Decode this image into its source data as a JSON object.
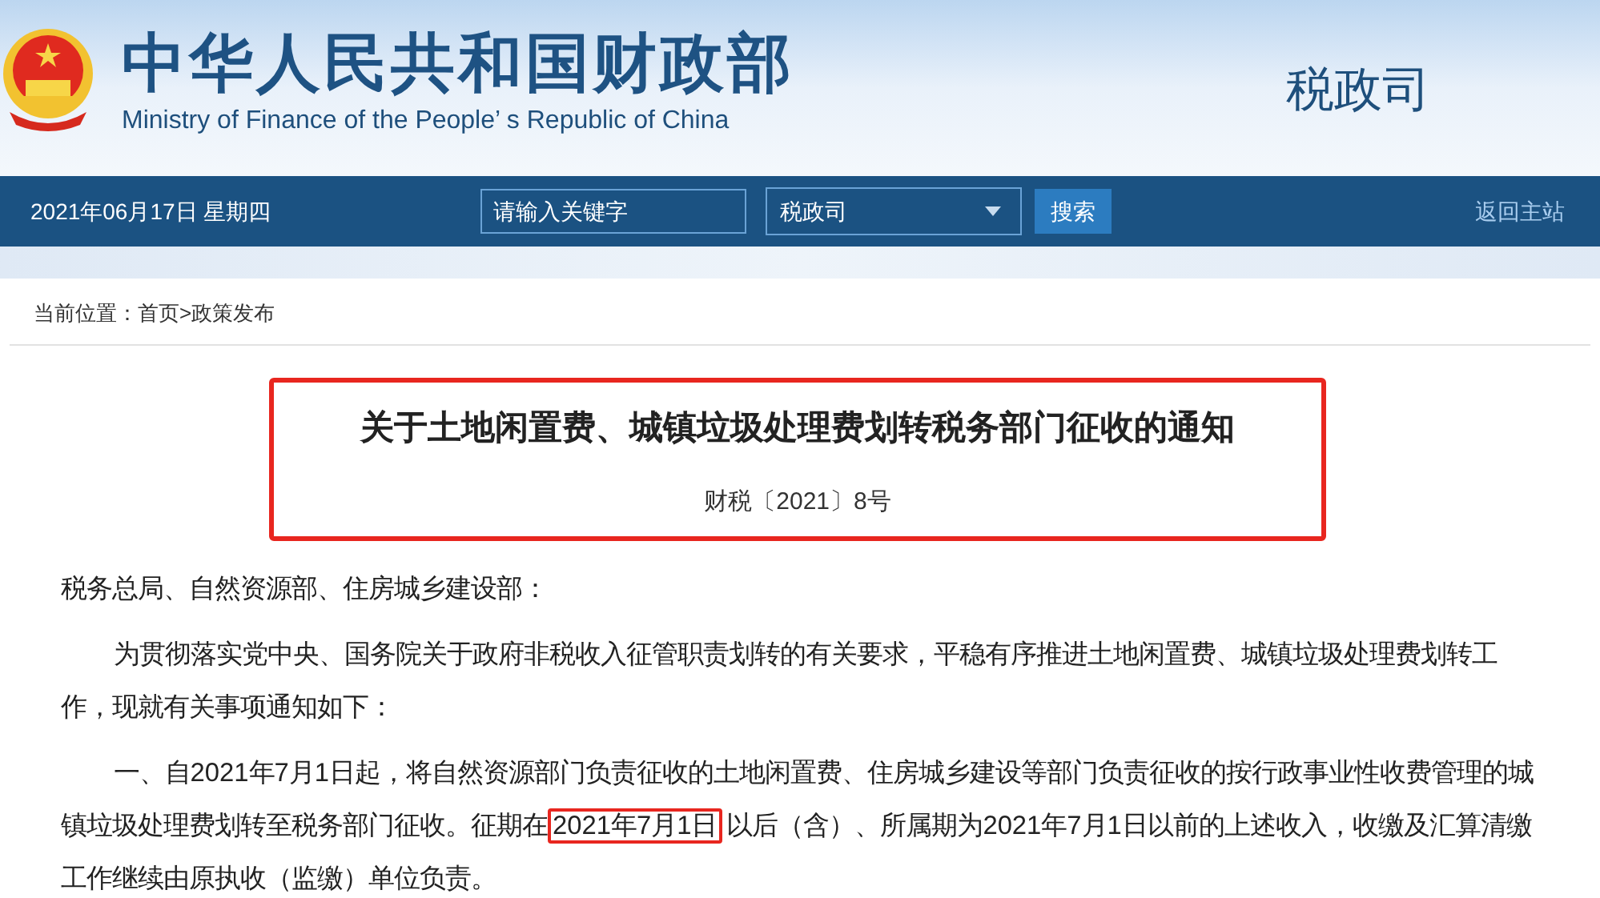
{
  "header": {
    "title": "中华人民共和国财政部",
    "subtitle": "Ministry of Finance of the People’ s Republic of China",
    "department": "税政司"
  },
  "nav": {
    "date": "2021年06月17日",
    "weekday": "星期四",
    "search": {
      "placeholder": "请输入关键字"
    },
    "scope": "税政司",
    "search_button": "搜索",
    "home_link": "返回主站"
  },
  "breadcrumb": {
    "label": "当前位置：",
    "items": [
      {
        "text": "首页"
      },
      {
        "text": ">"
      },
      {
        "text": "政策发布"
      }
    ]
  },
  "article": {
    "title": "关于土地闲置费、城镇垃圾处理费划转税务部门征收的通知",
    "doc_number": "财税〔2021〕8号",
    "title_highlighted": true,
    "paragraphs": [
      {
        "kind": "salutation",
        "parts": [
          {
            "text": "税务总局、自然资源部、住房城乡建设部：",
            "highlighted": false
          }
        ]
      },
      {
        "kind": "body",
        "parts": [
          {
            "text": "为贯彻落实党中央、国务院关于政府非税收入征管职责划转的有关要求，平稳有序推进土地闲置费、城镇垃圾处理费划转工作，现就有关事项通知如下：",
            "highlighted": false
          }
        ]
      },
      {
        "kind": "body",
        "parts": [
          {
            "text": "一、自2021年7月1日起，将自然资源部门负责征收的土地闲置费、住房城乡建设等部门负责征收的按行政事业性收费管理的城镇垃圾处理费划转至税务部门征收。征期在",
            "highlighted": false
          },
          {
            "text": "2021年7月1日",
            "highlighted": true
          },
          {
            "text": "以后（含）、所属期为2021年7月1日以前的上述收入，收缴及汇算清缴工作继续由原执收（监缴）单位负责。",
            "highlighted": false
          }
        ]
      }
    ]
  }
}
